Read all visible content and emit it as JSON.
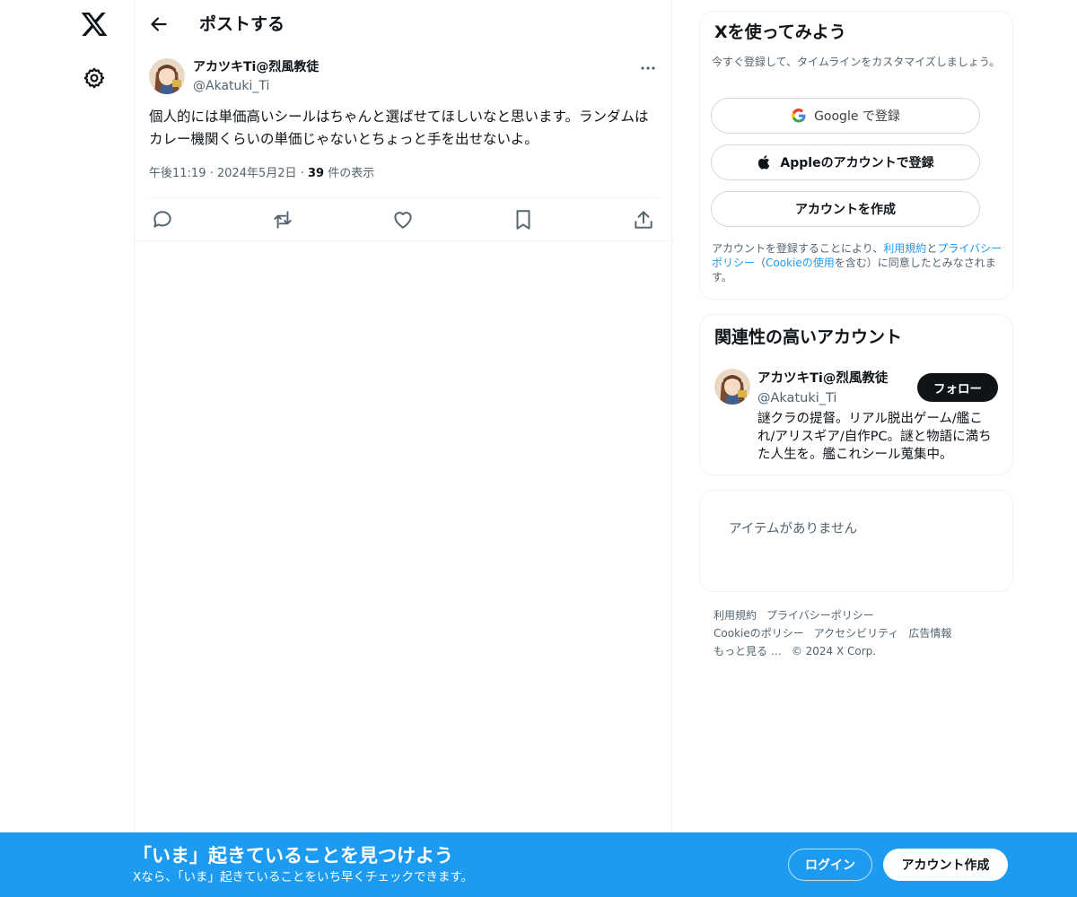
{
  "nav": {
    "logo_icon": "x-logo-icon",
    "settings_icon": "gear-icon"
  },
  "header": {
    "title": "ポストする",
    "back_icon": "arrow-left-icon"
  },
  "post": {
    "author_name": "アカツキTi@烈風教徒",
    "author_handle": "@Akatuki_Ti",
    "text": "個人的には単価高いシールはちゃんと選ばせてほしいなと思います。ランダムはカレー機関くらいの単価じゃないとちょっと手を出せないよ。",
    "time": "午後11:19",
    "date": "2024年5月2日",
    "separator": "·",
    "views_count": "39",
    "views_label": "件の表示",
    "actions": [
      "reply-icon",
      "repost-icon",
      "like-icon",
      "bookmark-icon",
      "share-icon"
    ]
  },
  "signup_card": {
    "title": "Xを使ってみよう",
    "subtitle": "今すぐ登録して、タイムラインをカスタマイズしましょう。",
    "google_label": "Google で登録",
    "apple_label": "Appleのアカウントで登録",
    "create_label": "アカウントを作成",
    "legal_prefix": "アカウントを登録することにより、",
    "legal_terms": "利用規約",
    "legal_and": "と",
    "legal_privacy": "プライバシーポリシー",
    "legal_open": "（",
    "legal_cookie": "Cookieの使用",
    "legal_suffix": "を含む）に同意したとみなされます。"
  },
  "related": {
    "title": "関連性の高いアカウント",
    "name": "アカツキTi@烈風教徒",
    "handle": "@Akatuki_Ti",
    "follow_label": "フォロー",
    "bio": "謎クラの提督。リアル脱出ゲーム/艦これ/アリスギア/自作PC。謎と物語に満ちた人生を。艦これシール蒐集中。"
  },
  "trends": {
    "empty_text": "アイテムがありません"
  },
  "footer": {
    "links": [
      "利用規約",
      "プライバシーポリシー",
      "Cookieのポリシー",
      "アクセシビリティ",
      "広告情報",
      "もっと見る …",
      "© 2024 X Corp."
    ]
  },
  "banner": {
    "title": "「いま」起きていることを見つけよう",
    "subtitle": "Xなら、「いま」起きていることをいち早くチェックできます。",
    "login_label": "ログイン",
    "signup_label": "アカウント作成"
  },
  "colors": {
    "accent": "#1d9bf0",
    "text": "#0f1419",
    "secondary_text": "#536471",
    "border": "#eff3f4"
  }
}
